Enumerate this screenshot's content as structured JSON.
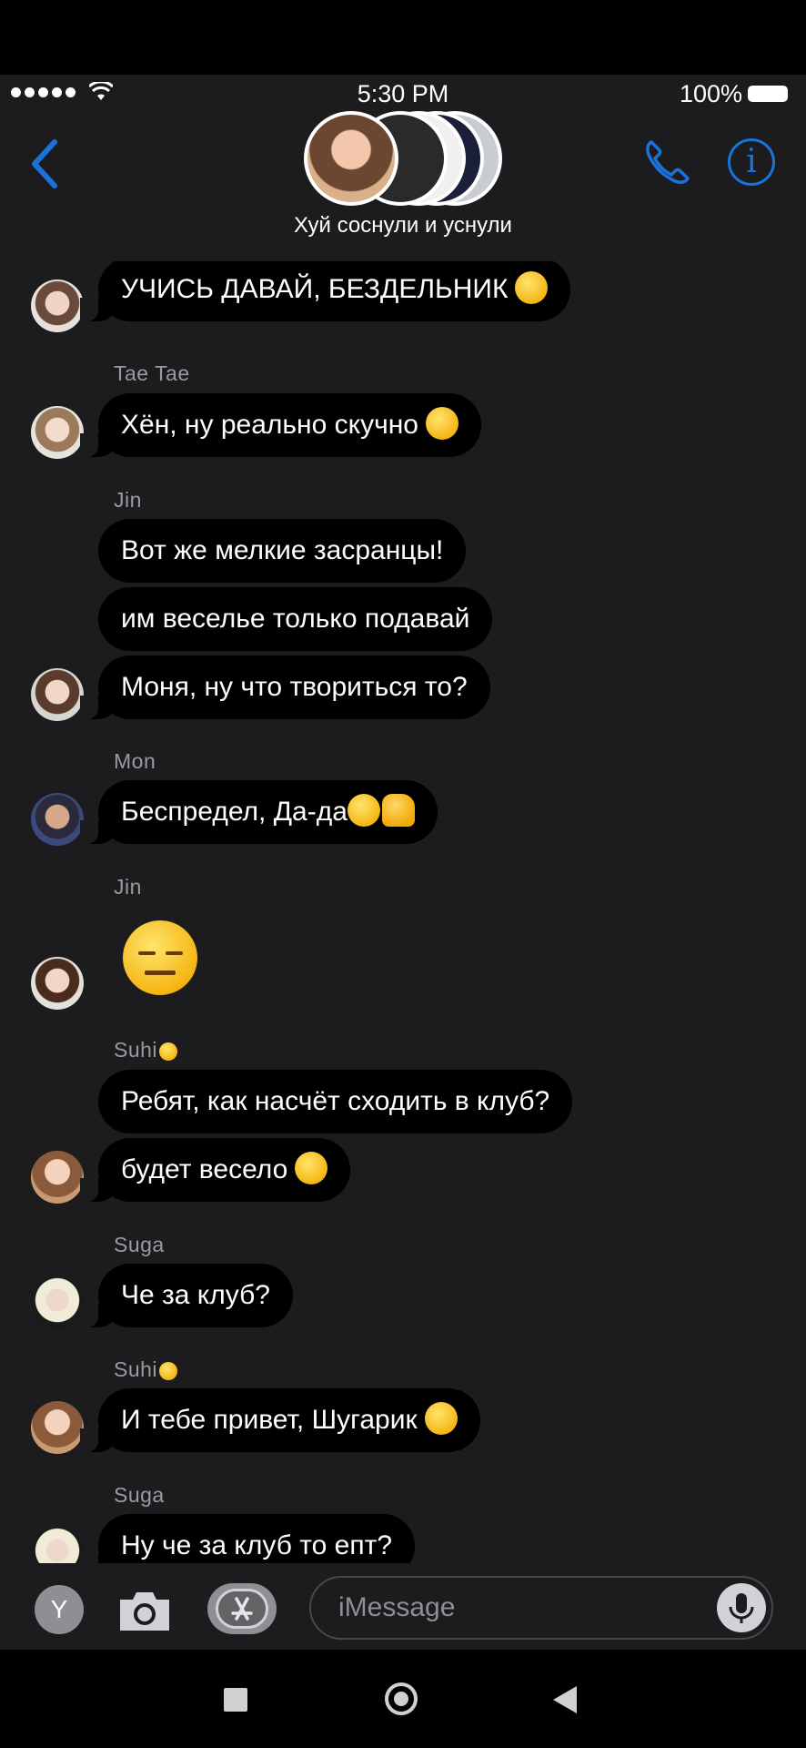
{
  "status": {
    "time": "5:30 PM",
    "battery": "100%"
  },
  "header": {
    "group_name": "Хуй соснули и уснули"
  },
  "messages": [
    {
      "sender": "",
      "text": "УЧИСЬ ДАВАЙ, БЕЗДЕЛЬНИК",
      "emoji": "monocle-face"
    },
    {
      "sender": "Tae Tae",
      "text": "Хён, ну реально скучно",
      "emoji": "smirking-face"
    },
    {
      "sender": "Jin",
      "text": "Вот же мелкие засранцы!"
    },
    {
      "sender": "",
      "text": "им веселье только подавай"
    },
    {
      "sender": "",
      "text": "Моня, ну что твориться то?"
    },
    {
      "sender": "Mon",
      "text": "Беспредел, Да-да",
      "emoji": "grinning-face thumbs-up"
    },
    {
      "sender": "Jin",
      "text": "",
      "emoji": "expressionless-face"
    },
    {
      "sender": "Suhi",
      "text": "Ребят, как насчёт сходить в клуб?"
    },
    {
      "sender": "",
      "text": "будет весело",
      "emoji": "winking-face"
    },
    {
      "sender": "Suga",
      "text": "Че за клуб?"
    },
    {
      "sender": "Suhi",
      "text": "И тебе привет, Шугарик",
      "emoji": "unamused-face"
    },
    {
      "sender": "Suga",
      "text": "Ну че за клуб то епт?"
    }
  ],
  "composer": {
    "y_label": "Y",
    "placeholder": "iMessage"
  },
  "colors": {
    "accent": "#1a73d9",
    "chat_bg": "#1c1c1e",
    "bubble": "#000000"
  }
}
